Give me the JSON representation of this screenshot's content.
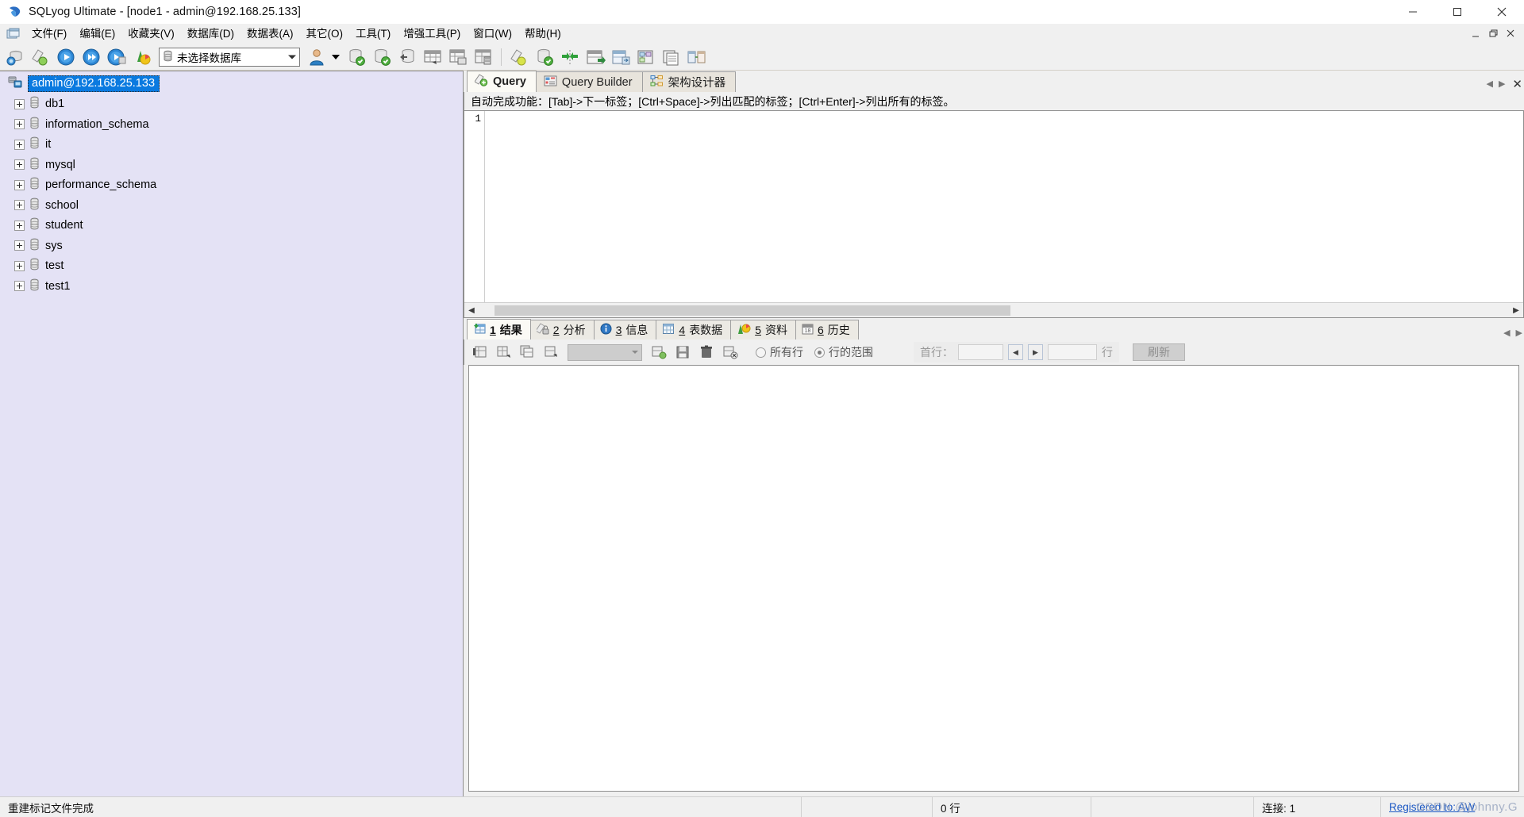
{
  "window": {
    "title": "SQLyog Ultimate - [node1 - admin@192.168.25.133]",
    "app_icon": "sqlyog-dolphin-icon",
    "minimize_label": "Minimize",
    "maximize_label": "Maximize",
    "close_label": "Close"
  },
  "menubar": {
    "mdi_icon": "mdi-window-icon",
    "items": [
      {
        "label": "文件(F)",
        "name": "menu-file"
      },
      {
        "label": "编辑(E)",
        "name": "menu-edit"
      },
      {
        "label": "收藏夹(V)",
        "name": "menu-favorites"
      },
      {
        "label": "数据库(D)",
        "name": "menu-database"
      },
      {
        "label": "数据表(A)",
        "name": "menu-table"
      },
      {
        "label": "其它(O)",
        "name": "menu-other"
      },
      {
        "label": "工具(T)",
        "name": "menu-tools"
      },
      {
        "label": "增强工具(P)",
        "name": "menu-powertools"
      },
      {
        "label": "窗口(W)",
        "name": "menu-window"
      },
      {
        "label": "帮助(H)",
        "name": "menu-help"
      }
    ],
    "mdi_buttons": [
      "mdi-minimize",
      "mdi-restore",
      "mdi-close"
    ]
  },
  "toolbar": {
    "db_selector_value": "未选择数据库",
    "db_selector_icon": "database-icon",
    "buttons": [
      {
        "name": "new-connection-button",
        "icon": "connection-icon"
      },
      {
        "name": "refresh-object-browser-button",
        "icon": "flask-icon"
      },
      {
        "name": "execute-query-button",
        "icon": "play-icon"
      },
      {
        "name": "execute-all-queries-button",
        "icon": "play-all-icon"
      },
      {
        "name": "execute-query-stop-button",
        "icon": "play-stop-icon"
      },
      {
        "name": "backup-restore-button",
        "icon": "backup-icon"
      },
      {
        "name": "user-manager-button",
        "icon": "user-icon"
      },
      {
        "name": "create-database-button",
        "icon": "db-add-icon"
      },
      {
        "name": "alter-database-button",
        "icon": "db-alter-icon"
      },
      {
        "name": "drop-database-button",
        "icon": "db-drop-icon"
      },
      {
        "name": "create-table-button",
        "icon": "table-new-icon"
      },
      {
        "name": "alter-table-button",
        "icon": "table-alter-icon"
      },
      {
        "name": "manage-index-button",
        "icon": "table-index-icon"
      },
      {
        "name": "sql-scheduler-button",
        "icon": "flask2-icon"
      },
      {
        "name": "db-sync-button",
        "icon": "db-sync-icon"
      },
      {
        "name": "data-sync-button",
        "icon": "sync-arrows-icon"
      },
      {
        "name": "import-external-data-button",
        "icon": "import-icon"
      },
      {
        "name": "export-data-button",
        "icon": "export-icon"
      },
      {
        "name": "schema-designer-button",
        "icon": "designer-icon"
      },
      {
        "name": "copy-db-button",
        "icon": "copy-db-icon"
      },
      {
        "name": "data-compare-button",
        "icon": "compare-icon"
      }
    ]
  },
  "object_browser": {
    "root": {
      "label": "admin@192.168.25.133",
      "icon": "server-icon",
      "selected": true
    },
    "databases": [
      {
        "label": "db1",
        "icon": "database-icon"
      },
      {
        "label": "information_schema",
        "icon": "database-icon"
      },
      {
        "label": "it",
        "icon": "database-icon"
      },
      {
        "label": "mysql",
        "icon": "database-icon"
      },
      {
        "label": "performance_schema",
        "icon": "database-icon"
      },
      {
        "label": "school",
        "icon": "database-icon"
      },
      {
        "label": "student",
        "icon": "database-icon"
      },
      {
        "label": "sys",
        "icon": "database-icon"
      },
      {
        "label": "test",
        "icon": "database-icon"
      },
      {
        "label": "test1",
        "icon": "database-icon"
      }
    ]
  },
  "query_tabs": {
    "tabs": [
      {
        "label": "Query",
        "icon": "query-icon",
        "active": true
      },
      {
        "label": "Query Builder",
        "icon": "query-builder-icon",
        "active": false
      },
      {
        "label": "架构设计器",
        "icon": "schema-designer-icon",
        "active": false
      }
    ],
    "prev_label": "◀",
    "next_label": "▶",
    "close_label": "✕"
  },
  "editor": {
    "hint": "自动完成功能：[Tab]->下一标签；[Ctrl+Space]->列出匹配的标签；[Ctrl+Enter]->列出所有的标签。",
    "line_number": "1",
    "content": ""
  },
  "result_tabs": {
    "tabs": [
      {
        "num": "1",
        "label": "结果",
        "icon": "result-grid-icon",
        "active": true
      },
      {
        "num": "2",
        "label": "分析",
        "icon": "profiler-icon",
        "active": false
      },
      {
        "num": "3",
        "label": "信息",
        "icon": "info-icon",
        "active": false
      },
      {
        "num": "4",
        "label": "表数据",
        "icon": "table-data-icon",
        "active": false
      },
      {
        "num": "5",
        "label": "资料",
        "icon": "objects-icon",
        "active": false
      },
      {
        "num": "6",
        "label": "历史",
        "icon": "history-icon",
        "active": false
      }
    ],
    "prev_label": "◀",
    "next_label": "▶"
  },
  "result_toolbar": {
    "buttons": [
      {
        "name": "first-row-button",
        "icon": "grid-first-icon"
      },
      {
        "name": "insert-row-button",
        "icon": "grid-insert-icon"
      },
      {
        "name": "duplicate-row-button",
        "icon": "grid-duplicate-icon"
      },
      {
        "name": "edit-row-button",
        "icon": "grid-edit-icon"
      }
    ],
    "combo_value": "",
    "buttons2": [
      {
        "name": "apply-changes-button",
        "icon": "grid-apply-icon"
      },
      {
        "name": "save-button",
        "icon": "save-icon"
      },
      {
        "name": "delete-row-button",
        "icon": "trash-icon"
      },
      {
        "name": "cancel-changes-button",
        "icon": "grid-cancel-icon"
      }
    ],
    "radio_all_rows": "所有行",
    "radio_row_range": "行的范围",
    "selected_radio": "行的范围",
    "first_row_label": "首行：",
    "first_row_value": "",
    "prev_page_label": "◀",
    "next_page_label": "▶",
    "row_count_value": "",
    "row_unit_label": "行",
    "refresh_label": "刷新"
  },
  "statusbar": {
    "message": "重建标记文件完成",
    "cell2": "",
    "row_count": "0 行",
    "cell4": "",
    "connection": "连接: 1",
    "registered": "Registered to: AW",
    "watermark": "CSDN @johnny.G"
  }
}
